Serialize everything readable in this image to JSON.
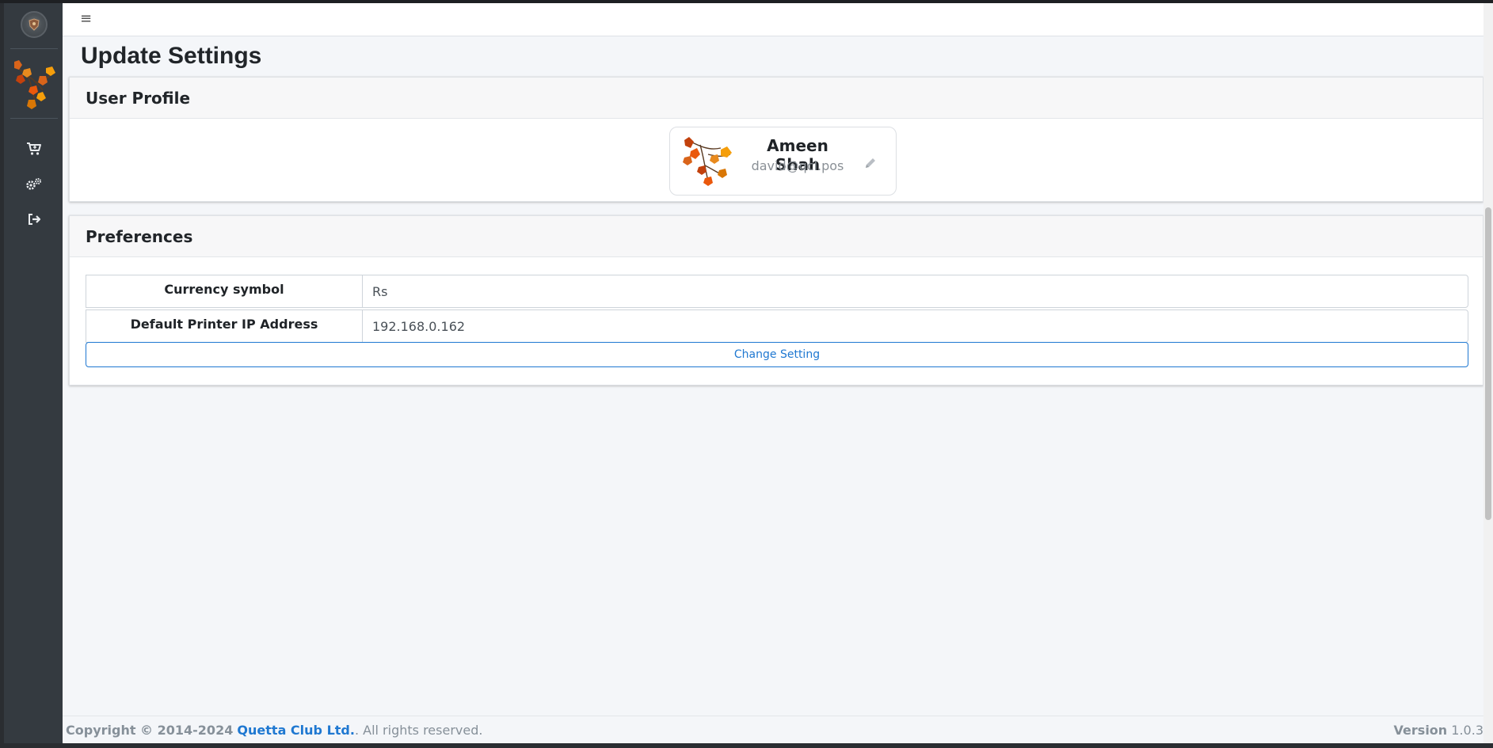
{
  "header": {
    "menu_icon": "≡"
  },
  "sidebar": {
    "items": [
      {
        "name": "cart-icon"
      },
      {
        "name": "settings-icon"
      },
      {
        "name": "logout-icon"
      }
    ]
  },
  "page": {
    "title": "Update Settings"
  },
  "user_profile": {
    "heading": "User Profile",
    "name": "Ameen Shah",
    "email": "david@qcl.pos"
  },
  "preferences": {
    "heading": "Preferences",
    "fields": [
      {
        "label": "Currency symbol",
        "value": "Rs"
      },
      {
        "label": "Default Printer IP Address",
        "value": "192.168.0.162"
      }
    ],
    "button_label": "Change Setting"
  },
  "footer": {
    "copyright_prefix": "Copyright © 2014-2024",
    "company": "Quetta Club Ltd.",
    "copyright_suffix": ". All rights reserved.",
    "version_label": "Version",
    "version_value": "1.0.3"
  },
  "colors": {
    "sidebar_bg": "#343a40",
    "link_blue": "#1f78d1",
    "content_bg": "#f4f6f9"
  }
}
